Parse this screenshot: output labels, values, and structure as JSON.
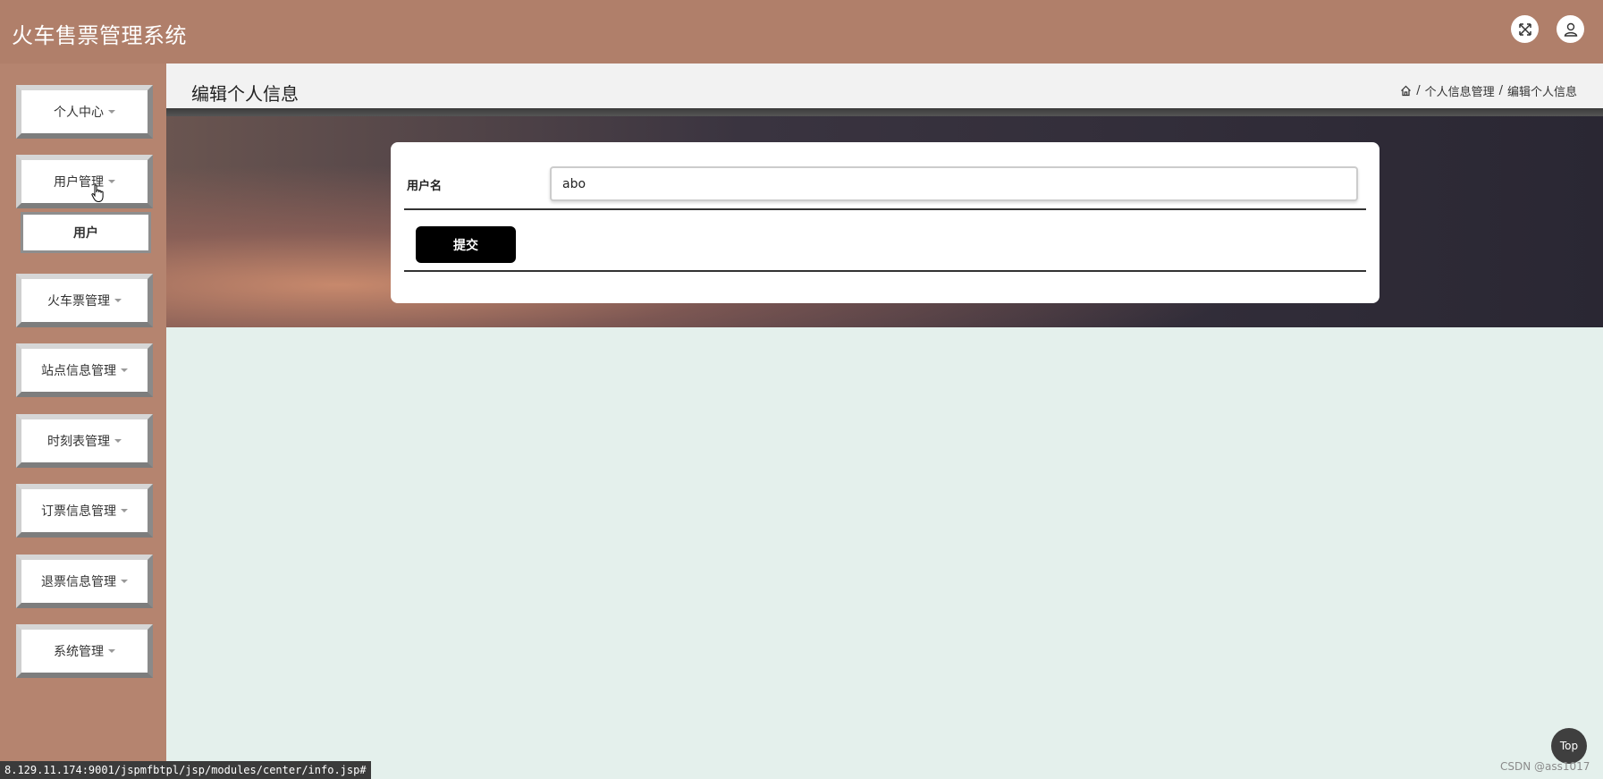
{
  "app": {
    "title": "火车售票管理系统"
  },
  "header": {
    "fullscreen_icon": "expand-arrows-icon",
    "user_icon": "user-icon"
  },
  "sidebar": {
    "items": [
      {
        "label": "个人中心"
      },
      {
        "label": "用户管理",
        "expanded": true,
        "children": [
          {
            "label": "用户"
          }
        ]
      },
      {
        "label": "火车票管理"
      },
      {
        "label": "站点信息管理"
      },
      {
        "label": "时刻表管理"
      },
      {
        "label": "订票信息管理"
      },
      {
        "label": "退票信息管理"
      },
      {
        "label": "系统管理"
      }
    ]
  },
  "page": {
    "title": "编辑个人信息",
    "breadcrumb": [
      "个人信息管理",
      "编辑个人信息"
    ]
  },
  "form": {
    "username_label": "用户名",
    "username_value": "abo",
    "submit_label": "提交"
  },
  "footer": {
    "status_url": "8.129.11.174:9001/jspmfbtpl/jsp/modules/center/info.jsp#",
    "top_button": "Top",
    "watermark": "CSDN @ass1017"
  },
  "colors": {
    "header_bg": "#b07f6a",
    "sidebar_bg": "#b5846f",
    "content_bg": "#e4f0ec",
    "button_bg": "#000000"
  }
}
